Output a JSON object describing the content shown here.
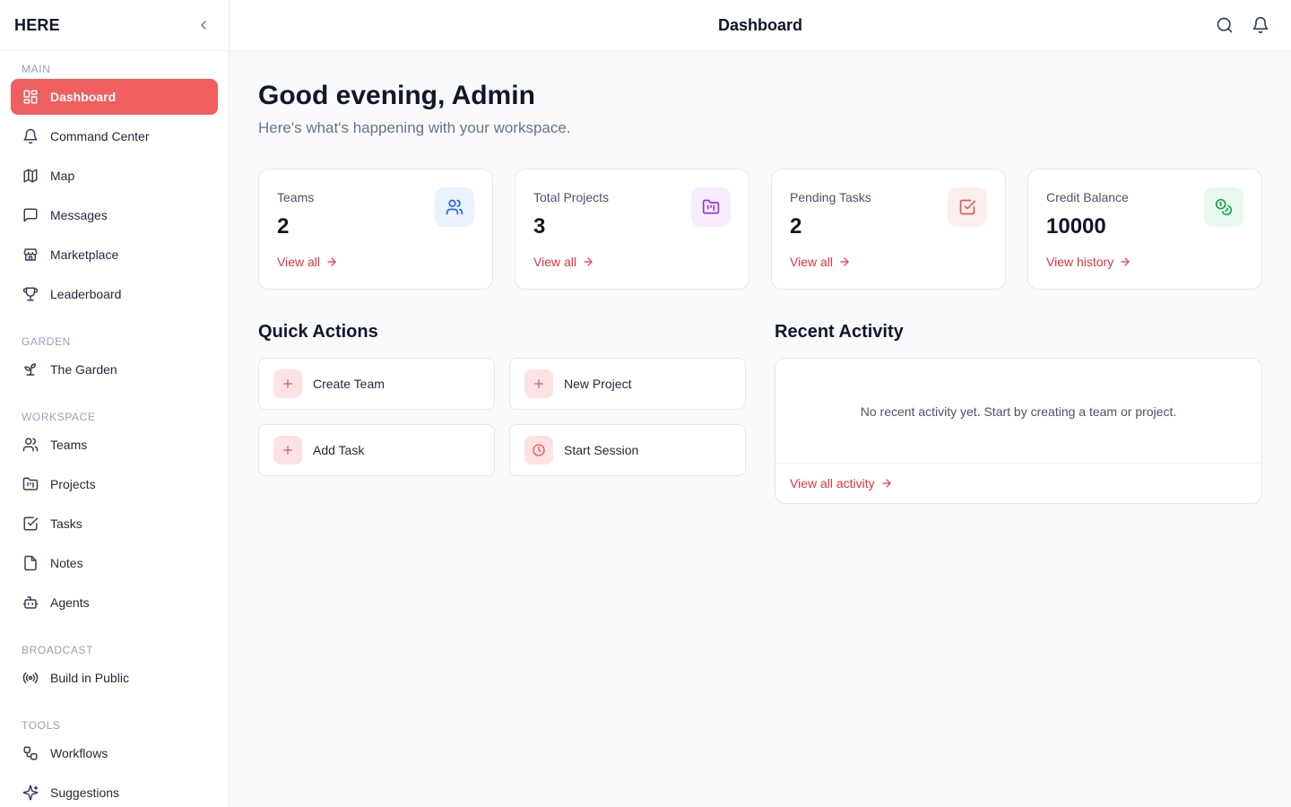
{
  "sidebar": {
    "brand": "HERE",
    "sections": {
      "main": "MAIN",
      "garden": "GARDEN",
      "workspace": "WORKSPACE",
      "broadcast": "BROADCAST",
      "tools": "TOOLS"
    },
    "items": {
      "dashboard": "Dashboard",
      "command_center": "Command Center",
      "map": "Map",
      "messages": "Messages",
      "marketplace": "Marketplace",
      "leaderboard": "Leaderboard",
      "garden": "The Garden",
      "teams": "Teams",
      "projects": "Projects",
      "tasks": "Tasks",
      "notes": "Notes",
      "agents": "Agents",
      "build_in_public": "Build in Public",
      "workflows": "Workflows",
      "suggestions": "Suggestions"
    },
    "active_color": "#f05f5f"
  },
  "topbar": {
    "title": "Dashboard"
  },
  "main": {
    "greeting": "Good evening, Admin",
    "subtitle": "Here's what's happening with your workspace.",
    "stats": {
      "teams": {
        "label": "Teams",
        "value": "2",
        "link": "View all"
      },
      "projects": {
        "label": "Total Projects",
        "value": "3",
        "link": "View all"
      },
      "tasks": {
        "label": "Pending Tasks",
        "value": "2",
        "link": "View all"
      },
      "credits": {
        "label": "Credit Balance",
        "value": "10000",
        "link": "View history"
      }
    },
    "quick_actions": {
      "title": "Quick Actions",
      "create_team": "Create Team",
      "new_project": "New Project",
      "add_task": "Add Task",
      "start_session": "Start Session"
    },
    "recent_activity": {
      "title": "Recent Activity",
      "empty": "No recent activity yet. Start by creating a team or project.",
      "link": "View all activity"
    }
  },
  "colors": {
    "accent": "#f05f5f",
    "link": "#dc3545",
    "teams_icon_bg": "#eaf2fd",
    "projects_icon_bg": "#f7ecfd",
    "tasks_icon_bg": "#fdeeee",
    "credits_icon_bg": "#e8f8ee"
  }
}
